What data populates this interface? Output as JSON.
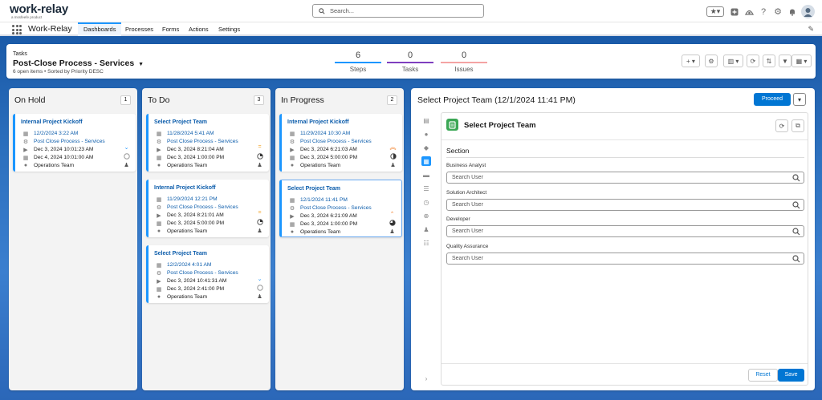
{
  "app": {
    "logo_text": "work-relay",
    "logo_sub": "a mssfeefe product",
    "name": "Work-Relay",
    "search_placeholder": "Search..."
  },
  "nav": {
    "tabs": [
      {
        "label": "Dashboards",
        "active": true
      },
      {
        "label": "Processes",
        "active": false
      },
      {
        "label": "Forms",
        "active": false
      },
      {
        "label": "Actions",
        "active": false
      },
      {
        "label": "Settings",
        "active": false
      }
    ]
  },
  "header": {
    "context": "Tasks",
    "title": "Post-Close Process - Services",
    "subtitle": "6 open items • Sorted by Priority DESC",
    "metrics": [
      {
        "value": "6",
        "label": "Steps",
        "color": "#1b96ff"
      },
      {
        "value": "0",
        "label": "Tasks",
        "color": "#7f3fbf"
      },
      {
        "value": "0",
        "label": "Issues",
        "color": "#f4a3a3"
      }
    ]
  },
  "columns": [
    {
      "title": "On Hold",
      "count": "1",
      "cards": [
        {
          "title": "Internal Project Kickoff",
          "date": "12/2/2024 3:22 AM",
          "process": "Post Close Process - Services",
          "start": "Dec 3, 2024 10:01:23 AM",
          "due": "Dec 4, 2024 10:01:00 AM",
          "team": "Operations Team",
          "priority": "low",
          "selected": false
        }
      ]
    },
    {
      "title": "To Do",
      "count": "3",
      "cards": [
        {
          "title": "Select Project Team",
          "date": "11/28/2024 5:41 AM",
          "process": "Post Close Process - Services",
          "start": "Dec 3, 2024 8:21:04 AM",
          "due": "Dec 3, 2024 1:00:00 PM",
          "team": "Operations Team",
          "priority": "medium",
          "selected": false
        },
        {
          "title": "Internal Project Kickoff",
          "date": "11/29/2024 12:21 PM",
          "process": "Post Close Process - Services",
          "start": "Dec 3, 2024 8:21:01 AM",
          "due": "Dec 3, 2024 5:00:00 PM",
          "team": "Operations Team",
          "priority": "medium",
          "selected": false
        },
        {
          "title": "Select Project Team",
          "date": "12/2/2024 4:01 AM",
          "process": "Post Close Process - Services",
          "start": "Dec 3, 2024 10:41:31 AM",
          "due": "Dec 3, 2024 2:41:00 PM",
          "team": "Operations Team",
          "priority": "low",
          "selected": false
        }
      ]
    },
    {
      "title": "In Progress",
      "count": "2",
      "cards": [
        {
          "title": "Internal Project Kickoff",
          "date": "11/29/2024 10:30 AM",
          "process": "Post Close Process - Services",
          "start": "Dec 3, 2024 6:21:03 AM",
          "due": "Dec 3, 2024 5:00:00 PM",
          "team": "Operations Team",
          "priority": "high",
          "selected": false
        },
        {
          "title": "Select Project Team",
          "date": "12/1/2024 11:41 PM",
          "process": "Post Close Process - Services",
          "start": "Dec 3, 2024 6:21:09 AM",
          "due": "Dec 3, 2024 1:00:00 PM",
          "team": "Operations Team",
          "priority": "high-single",
          "selected": true
        }
      ]
    }
  ],
  "detail": {
    "title": "Select Project Team (12/1/2024 11:41 PM)",
    "proceed_label": "Proceed",
    "panel_title": "Select Project Team",
    "section_title": "Section",
    "fields": [
      {
        "label": "Business Analyst",
        "placeholder": "Search User"
      },
      {
        "label": "Solution Architect",
        "placeholder": "Search User"
      },
      {
        "label": "Developer",
        "placeholder": "Search User"
      },
      {
        "label": "Quality Assurance",
        "placeholder": "Search User"
      }
    ],
    "reset_label": "Reset",
    "save_label": "Save"
  }
}
